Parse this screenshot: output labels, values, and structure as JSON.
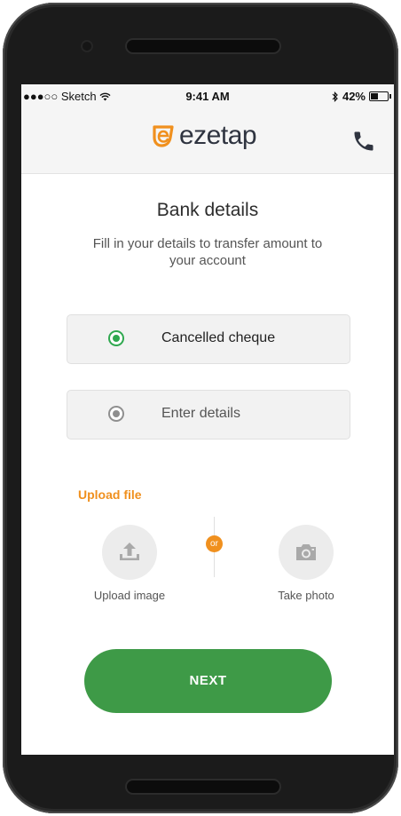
{
  "status_bar": {
    "carrier": "●●●○○ Sketch",
    "time": "9:41 AM",
    "battery": "42%",
    "battery_level_percent": 42
  },
  "header": {
    "brand": "ezetap",
    "icons": {
      "logo": "ezetap-logo-icon",
      "call": "phone-icon"
    },
    "brand_color": "#f0901e"
  },
  "page": {
    "title": "Bank details",
    "subtitle": "Fill in your details to transfer amount to your account"
  },
  "options": [
    {
      "label": "Cancelled cheque",
      "selected": true
    },
    {
      "label": "Enter details",
      "selected": false
    }
  ],
  "upload": {
    "section_label": "Upload file",
    "separator": "or",
    "upload_caption": "Upload image",
    "photo_caption": "Take photo",
    "icons": {
      "upload": "upload-icon",
      "photo": "camera-icon"
    }
  },
  "actions": {
    "next_label": "NEXT"
  },
  "colors": {
    "accent": "#f0901e",
    "primary_button": "#3e9a47",
    "radio_selected": "#2fa84f"
  }
}
